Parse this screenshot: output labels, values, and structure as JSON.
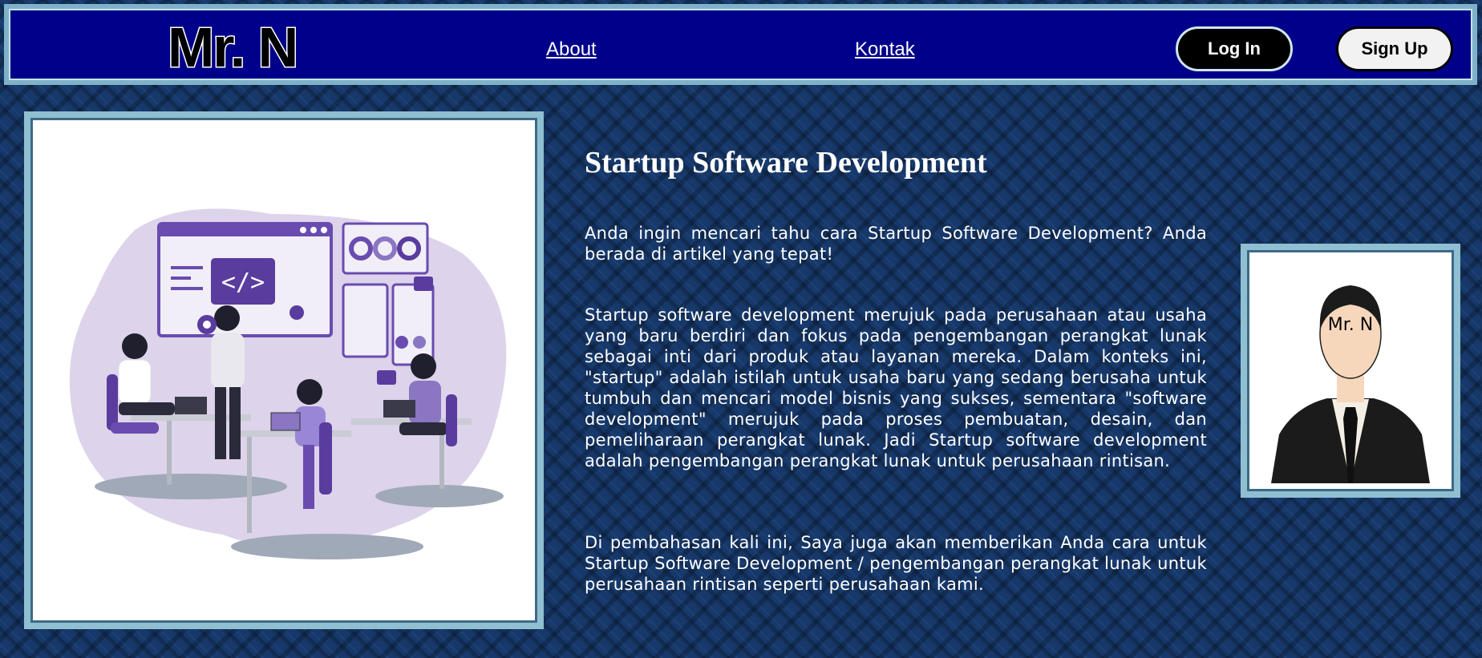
{
  "header": {
    "logo": "Mr. N",
    "links": [
      "About",
      "Kontak"
    ],
    "login_label": "Log In",
    "signup_label": "Sign Up"
  },
  "article": {
    "title": "Startup Software Development",
    "paragraphs": [
      "Anda ingin mencari tahu cara Startup Software Development? Anda berada di artikel yang tepat!",
      " Startup software development merujuk pada perusahaan atau usaha yang baru berdiri dan fokus pada pengembangan perangkat lunak sebagai inti dari produk atau layanan mereka. Dalam konteks ini, \"startup\" adalah istilah untuk usaha baru yang sedang berusaha untuk tumbuh dan mencari model bisnis yang sukses, sementara \"software development\" merujuk pada proses pembuatan, desain, dan pemeliharaan perangkat lunak. Jadi Startup software development adalah pengembangan perangkat lunak untuk perusahaan rintisan.",
      "Di pembahasan kali ini, Saya juga akan memberikan Anda cara untuk Startup Software Development / pengembangan perangkat lunak untuk perusahaan rintisan seperti perusahaan kami."
    ]
  },
  "illustration": {
    "code_tag": "</>",
    "braces": "{ }"
  },
  "profile": {
    "face_label": "Mr. N"
  },
  "colors": {
    "nav_bg": "#00008b",
    "page_bg": "#16386a",
    "accent_purple": "#6a4bb0",
    "frame_border": "#8fbfd0"
  }
}
